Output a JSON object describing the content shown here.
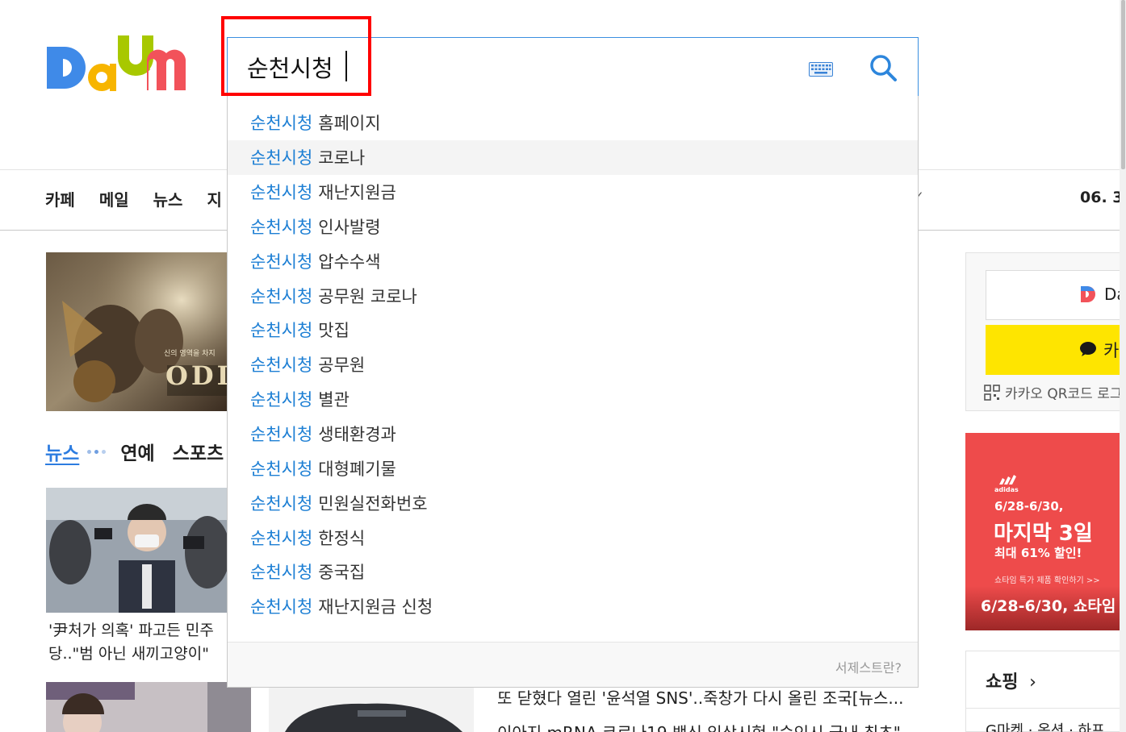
{
  "colors": {
    "accent_blue": "#1d7fd4",
    "highlight_red": "#ff0000",
    "kakao_yellow": "#fee500",
    "ad_red": "#ee4b4b",
    "logo_blue": "#3f8ae8",
    "logo_yellow": "#f7b500",
    "logo_green": "#a8c800",
    "logo_red": "#f2525a"
  },
  "search": {
    "value": "순천시청",
    "keyboard_icon": "keyboard-icon",
    "search_icon": "magnifier-icon"
  },
  "suggestions": {
    "keyword": "순천시청",
    "items": [
      "홈페이지",
      "코로나",
      "재난지원금",
      "인사발령",
      "압수수색",
      "공무원 코로나",
      "맛집",
      "공무원",
      "별관",
      "생태환경과",
      "대형폐기물",
      "민원실전화번호",
      "한정식",
      "중국집",
      "재난지원금 신청"
    ],
    "footer_link": "서제스트란?"
  },
  "nav": {
    "items": [
      "카페",
      "메일",
      "뉴스",
      "지"
    ],
    "date_text": "06. 3"
  },
  "news": {
    "tabs": [
      "뉴스",
      "연예",
      "스포츠"
    ],
    "caption_line1": "'尹처가 의혹' 파고든 민주",
    "caption_line2": "당..\"범 아닌 새끼고양이\"",
    "headline_1": "또 닫혔다 열린 '윤석열 SNS'..죽창가 다시 올린 조국[뉴스...",
    "headline_2": "이아지 mRNA 코로나19 백신 임상시험 \"승인시 국내 최초\""
  },
  "game_banner": {
    "logo_text": "ODI",
    "small_text": "신의 영역을 차지"
  },
  "login": {
    "daum_label": "Da",
    "kakao_label": "카",
    "qr_label": "카카오 QR코드 로그"
  },
  "ad": {
    "brand": "adidas",
    "dates": "6/28-6/30,",
    "main": "마지막 3일",
    "sub": "최대 61% 할인!",
    "small": "쇼타임 특가 제품 확인하기 >>",
    "caption": "6/28-6/30, 쇼타임 ?"
  },
  "shopping": {
    "title": "쇼핑",
    "items": "G마켓 · 옥션 · 하프"
  }
}
